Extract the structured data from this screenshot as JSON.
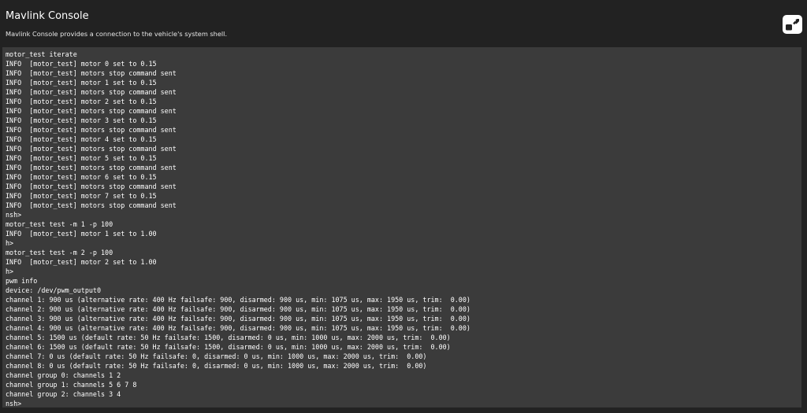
{
  "header": {
    "title": "Mavlink Console",
    "subtitle": "Mavlink Console provides a connection to the vehicle's system shell.",
    "popout_icon": "popout-icon"
  },
  "console": {
    "lines": [
      "motor_test iterate",
      "INFO  [motor_test] motor 0 set to 0.15",
      "INFO  [motor_test] motors stop command sent",
      "INFO  [motor_test] motor 1 set to 0.15",
      "INFO  [motor_test] motors stop command sent",
      "INFO  [motor_test] motor 2 set to 0.15",
      "INFO  [motor_test] motors stop command sent",
      "INFO  [motor_test] motor 3 set to 0.15",
      "INFO  [motor_test] motors stop command sent",
      "INFO  [motor_test] motor 4 set to 0.15",
      "INFO  [motor_test] motors stop command sent",
      "INFO  [motor_test] motor 5 set to 0.15",
      "INFO  [motor_test] motors stop command sent",
      "INFO  [motor_test] motor 6 set to 0.15",
      "INFO  [motor_test] motors stop command sent",
      "INFO  [motor_test] motor 7 set to 0.15",
      "INFO  [motor_test] motors stop command sent",
      "nsh>",
      "motor_test test -m 1 -p 100",
      "INFO  [motor_test] motor 1 set to 1.00",
      "h>",
      "motor_test test -m 2 -p 100",
      "INFO  [motor_test] motor 2 set to 1.00",
      "h>",
      "pwm info",
      "device: /dev/pwm_output0",
      "channel 1: 900 us (alternative rate: 400 Hz failsafe: 900, disarmed: 900 us, min: 1075 us, max: 1950 us, trim:  0.00)",
      "channel 2: 900 us (alternative rate: 400 Hz failsafe: 900, disarmed: 900 us, min: 1075 us, max: 1950 us, trim:  0.00)",
      "channel 3: 900 us (alternative rate: 400 Hz failsafe: 900, disarmed: 900 us, min: 1075 us, max: 1950 us, trim:  0.00)",
      "channel 4: 900 us (alternative rate: 400 Hz failsafe: 900, disarmed: 900 us, min: 1075 us, max: 1950 us, trim:  0.00)",
      "channel 5: 1500 us (default rate: 50 Hz failsafe: 1500, disarmed: 0 us, min: 1000 us, max: 2000 us, trim:  0.00)",
      "channel 6: 1500 us (default rate: 50 Hz failsafe: 1500, disarmed: 0 us, min: 1000 us, max: 2000 us, trim:  0.00)",
      "channel 7: 0 us (default rate: 50 Hz failsafe: 0, disarmed: 0 us, min: 1000 us, max: 2000 us, trim:  0.00)",
      "channel 8: 0 us (default rate: 50 Hz failsafe: 0, disarmed: 0 us, min: 1000 us, max: 2000 us, trim:  0.00)",
      "channel group 0: channels 1 2",
      "channel group 1: channels 5 6 7 8",
      "channel group 2: channels 3 4",
      "nsh>"
    ]
  },
  "colors": {
    "background": "#222222",
    "console_background": "#3b3b3b",
    "text": "#ffffff"
  }
}
